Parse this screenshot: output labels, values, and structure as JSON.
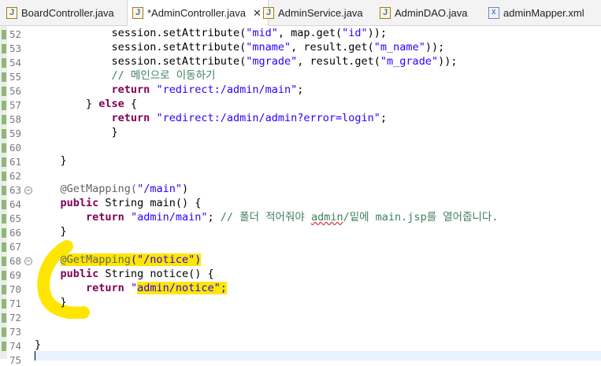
{
  "tabs": [
    {
      "label": "BoardController.java",
      "icon": "java-file-icon",
      "active": false
    },
    {
      "label": "*AdminController.java",
      "icon": "java-file-icon",
      "active": true,
      "close": "✕"
    },
    {
      "label": "AdminService.java",
      "icon": "java-file-icon",
      "active": false
    },
    {
      "label": "AdminDAO.java",
      "icon": "java-file-icon",
      "active": false
    },
    {
      "label": "adminMapper.xml",
      "icon": "xml-file-icon",
      "active": false
    }
  ],
  "line_numbers": [
    "52",
    "53",
    "54",
    "55",
    "56",
    "57",
    "58",
    "59",
    "60",
    "61",
    "62",
    "63",
    "64",
    "65",
    "66",
    "67",
    "68",
    "69",
    "70",
    "71",
    "72",
    "73",
    "74",
    "75"
  ],
  "code": {
    "l52": {
      "a": "            session.setAttribute(",
      "b": "\"mid\"",
      "c": ", map.get(",
      "d": "\"id\"",
      "e": "));"
    },
    "l53": {
      "a": "            session.setAttribute(",
      "b": "\"mname\"",
      "c": ", result.get(",
      "d": "\"m_name\"",
      "e": "));"
    },
    "l54": {
      "a": "            session.setAttribute(",
      "b": "\"mgrade\"",
      "c": ", result.get(",
      "d": "\"m_grade\"",
      "e": "));"
    },
    "l55": {
      "a": "            // 메인으로 이동하기"
    },
    "l56": {
      "kw": "return",
      "s": "\"redirect:/admin/main\"",
      "e": ";"
    },
    "l57": {
      "a": "        } ",
      "kw": "else",
      "e": " {"
    },
    "l58": {
      "kw": "return",
      "s": "\"redirect:/admin/admin?error=login\"",
      "e": ";"
    },
    "l59": {
      "a": "            }"
    },
    "l61": {
      "a": "    }"
    },
    "l63": {
      "ann": "@GetMapping(",
      "s": "\"/main\"",
      "e": ")"
    },
    "l64": {
      "kw": "public",
      "a": " String main() {"
    },
    "l65": {
      "kw": "return",
      "s": "\"admin/main\"",
      "e": "; ",
      "c1": "// 폴더 적어줘야 ",
      "c2": "admin",
      "c3": "/밑에 main.jsp를 열어줍니다."
    },
    "l66": {
      "a": "    }"
    },
    "l68": {
      "ann": "@GetMapping",
      "h": "(\"/notice\")"
    },
    "l69": {
      "kw": "public",
      "a": " String notice() {"
    },
    "l70": {
      "kw": "return",
      "s1": "\"",
      "h": "admin/notice\";"
    },
    "l71": {
      "a": "    }"
    },
    "l74": {
      "a": "}"
    }
  },
  "colors": {
    "keyword": "#7f0055",
    "string": "#2a00ff",
    "comment": "#3f7f5f",
    "highlight": "#ffe600"
  }
}
